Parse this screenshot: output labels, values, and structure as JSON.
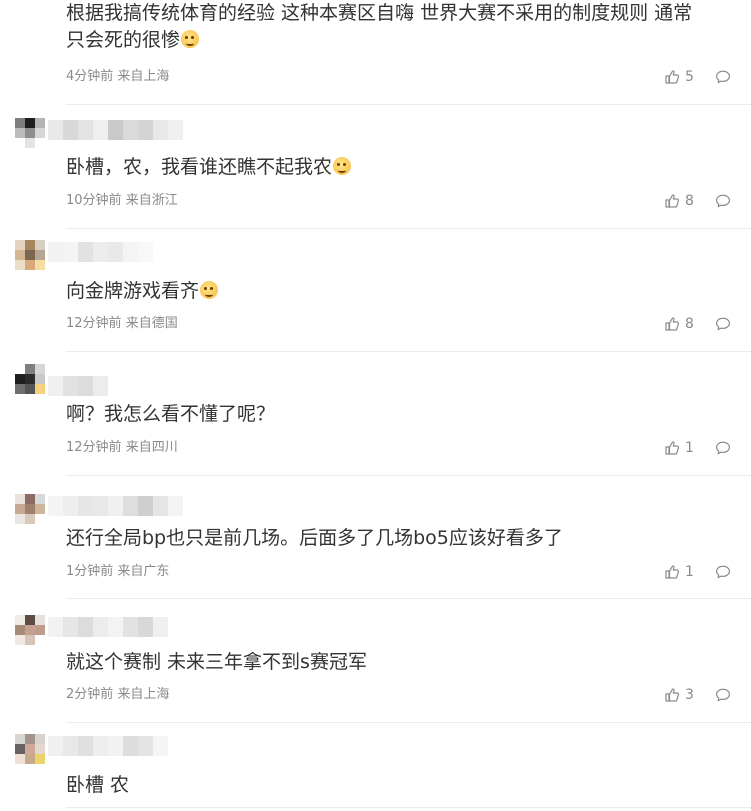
{
  "comments": [
    {
      "text": "根据我搞传统体育的经验 这种本赛区自嗨 世界大赛不采用的制度规则 通常\n只会死的很惨",
      "emoji": "smirk-emoji",
      "time": "4分钟前",
      "location": "来自上海",
      "likes": "5",
      "avatar": [
        "#ffffff",
        "#ffffff",
        "#ffffff",
        "#ffffff",
        "#ffffff",
        "#ffffff",
        "#ffffff",
        "#ffffff",
        "#ffffff"
      ],
      "name_blur": []
    },
    {
      "text": "卧槽，农，我看谁还瞧不起我农",
      "emoji": "dog-emoji",
      "time": "10分钟前",
      "location": "来自浙江",
      "likes": "8",
      "avatar": [
        "#7f7f7f",
        "#1e1e1e",
        "#b5b5b5",
        "#bcbcbc",
        "#8e8e8e",
        "#d6d6d6",
        "#ffffff",
        "#e4e4e4",
        "#ffffff"
      ],
      "name_blur": [
        "#e9e9e9",
        "#d8d8d8",
        "#e3e3e3",
        "#efefef",
        "#c9c9c9",
        "#dadada",
        "#d4d4d4",
        "#e8e8e8",
        "#f0f0f0"
      ]
    },
    {
      "text": "向金牌游戏看齐",
      "emoji": "dog-emoji",
      "time": "12分钟前",
      "location": "来自德国",
      "likes": "8",
      "avatar": [
        "#e5d3c2",
        "#a5875e",
        "#d7cfc0",
        "#d3b792",
        "#7b6851",
        "#b8a694",
        "#e9dcc9",
        "#d9a97a",
        "#f3dea3"
      ],
      "name_blur": [
        "#f2f2f2",
        "#f4f4f4",
        "#e2e2e2",
        "#ededed",
        "#e9e9e9",
        "#f5f5f5",
        "#f8f8f8",
        "#ffffff",
        "#ffffff"
      ]
    },
    {
      "text": "啊？我怎么看不懂了呢？",
      "emoji": "",
      "time": "12分钟前",
      "location": "来自四川",
      "likes": "1",
      "avatar": [
        "#ffffff",
        "#7e7e7e",
        "#d6d6d6",
        "#1f1f1f",
        "#2b2b2b",
        "#c8c8c8",
        "#6f6f6f",
        "#545454",
        "#f4d27c"
      ],
      "name_blur": [
        "#efefef",
        "#e1e1e1",
        "#dcdcdc",
        "#ececec"
      ]
    },
    {
      "text": "还行全局bp也只是前几场。后面多了几场bo5应该好看多了",
      "emoji": "",
      "time": "1分钟前",
      "location": "来自广东",
      "likes": "1",
      "avatar": [
        "#e8e2da",
        "#8a6a62",
        "#d8d8d8",
        "#c8a893",
        "#a0806f",
        "#ceb59b",
        "#e9e6e1",
        "#d8c9b8",
        "#ffffff"
      ],
      "name_blur": [
        "#f4f4f4",
        "#eeeeee",
        "#e6e6e6",
        "#e8e8e8",
        "#f0f0f0",
        "#dedede",
        "#cfcfcf",
        "#e5e5e5",
        "#f3f3f3"
      ]
    },
    {
      "text": "就这个赛制 未来三年拿不到s赛冠军",
      "emoji": "",
      "time": "2分钟前",
      "location": "来自上海",
      "likes": "3",
      "avatar": [
        "#f0ede9",
        "#5e4b41",
        "#e6e1da",
        "#a88a7a",
        "#c4a191",
        "#bf9d8b",
        "#efe8e3",
        "#d7c4b8",
        "#ffffff"
      ],
      "name_blur": [
        "#f2f2f2",
        "#e6e6e6",
        "#dcdcdc",
        "#ececec",
        "#f3f3f3",
        "#e2e2e2",
        "#d8d8d8",
        "#f0f0f0"
      ]
    },
    {
      "text": "卧槽 农",
      "emoji": "",
      "time": "",
      "location": "",
      "likes": "",
      "avatar": [
        "#d8d6d3",
        "#a4938a",
        "#d6d2cf",
        "#686262",
        "#cfa89a",
        "#e3d7cf",
        "#f1dfd6",
        "#c7a98b",
        "#ebd36d"
      ],
      "name_blur": [
        "#f0f0f0",
        "#e8e8e8",
        "#e0e0e0",
        "#eeeeee",
        "#f2f2f2",
        "#dddddd",
        "#e4e4e4",
        "#f5f5f5"
      ]
    }
  ],
  "icons": {
    "like": "thumbs-up-icon",
    "reply": "comment-bubble-icon"
  },
  "colors": {
    "text": "#333333",
    "meta": "#8a8a8a",
    "divider": "#ececec"
  }
}
